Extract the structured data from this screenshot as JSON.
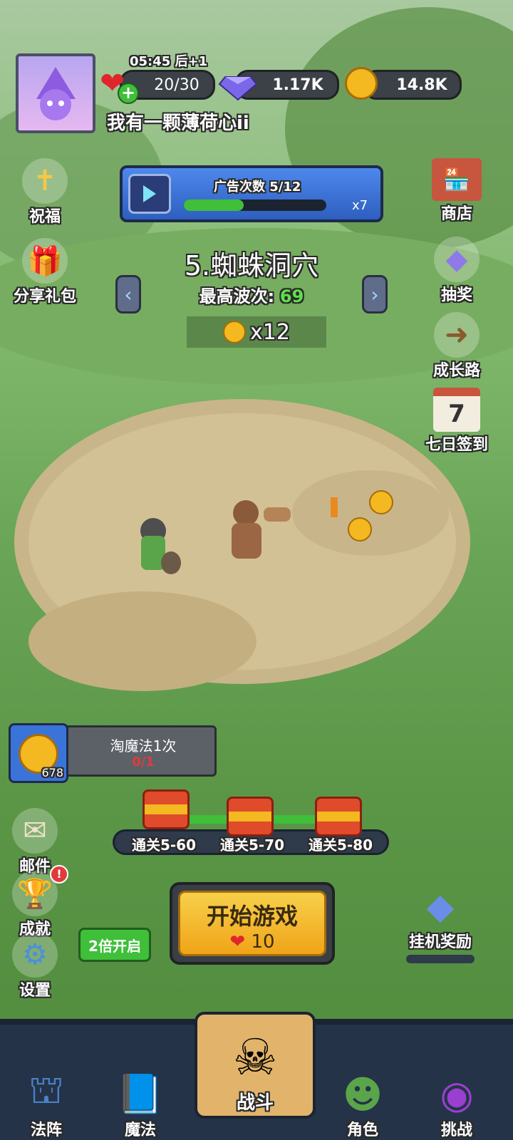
{
  "profile": {
    "username": "我有一颗薄荷心ii",
    "timer": "05:45 后+1"
  },
  "resources": {
    "energy": "20/30",
    "gems": "1.17K",
    "coins": "14.8K"
  },
  "ad_panel": {
    "title": "广告次数 5/12",
    "multiplier": "x7",
    "progress": 0.42
  },
  "stage": {
    "name": "5.蜘蛛洞穴",
    "best_wave_label": "最高波次:",
    "best_wave_value": "69",
    "coin_reward": "x12"
  },
  "left_menu": {
    "blessing": "祝福",
    "share_gift": "分享礼包"
  },
  "right_menu": {
    "shop": "商店",
    "lottery": "抽奖",
    "growth_road": "成长路",
    "seven_day_signin": "七日签到"
  },
  "magic_quest": {
    "count": "678",
    "title": "淘魔法1次",
    "progress_text": "0/1"
  },
  "chest_rewards": [
    {
      "label": "通关5-60"
    },
    {
      "label": "通关5-70"
    },
    {
      "label": "通关5-80"
    }
  ],
  "bottom_left": {
    "mail": "邮件",
    "achievements": "成就",
    "settings": "设置",
    "double_speed": "2倍开启"
  },
  "start_button": {
    "label": "开始游戏",
    "cost": "10"
  },
  "idle_reward": "挂机奖励",
  "nav": {
    "formation": "法阵",
    "magic": "魔法",
    "battle": "战斗",
    "character": "角色",
    "challenge": "挑战"
  },
  "colors": {
    "accent_blue": "#3d6fd6",
    "progress_green": "#3fbf3a",
    "start_yellow": "#f3b51f",
    "best_wave_green": "#5ee04a"
  }
}
